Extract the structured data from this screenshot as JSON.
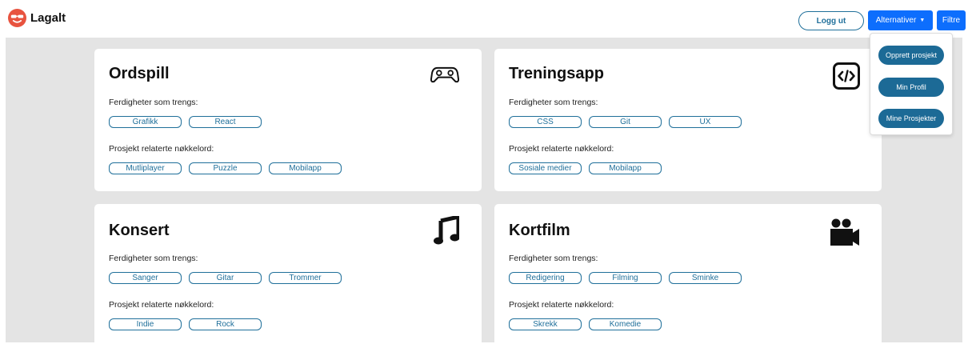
{
  "brand": {
    "name": "Lagalt"
  },
  "nav": {
    "logout": "Logg ut",
    "alternatives": "Alternativer",
    "filter": "Filtre"
  },
  "dropdown": {
    "items": [
      "Opprett prosjekt",
      "Min Profil",
      "Mine Prosjekter"
    ]
  },
  "projects": [
    {
      "title": "Ordspill",
      "icon": "gamepad-icon",
      "skills_label": "Ferdigheter som trengs:",
      "skills": [
        "Grafikk",
        "React"
      ],
      "keywords_label": "Prosjekt relaterte nøkkelord:",
      "keywords": [
        "Mutliplayer",
        "Puzzle",
        "Mobilapp"
      ]
    },
    {
      "title": "Treningsapp",
      "icon": "code-icon",
      "skills_label": "Ferdigheter som trengs:",
      "skills": [
        "CSS",
        "Git",
        "UX"
      ],
      "keywords_label": "Prosjekt relaterte nøkkelord:",
      "keywords": [
        "Sosiale medier",
        "Mobilapp"
      ]
    },
    {
      "title": "Konsert",
      "icon": "music-note-icon",
      "skills_label": "Ferdigheter som trengs:",
      "skills": [
        "Sanger",
        "Gitar",
        "Trommer"
      ],
      "keywords_label": "Prosjekt relaterte nøkkelord:",
      "keywords": [
        "Indie",
        "Rock"
      ]
    },
    {
      "title": "Kortfilm",
      "icon": "video-camera-icon",
      "skills_label": "Ferdigheter som trengs:",
      "skills": [
        "Redigering",
        "Filming",
        "Sminke"
      ],
      "keywords_label": "Prosjekt relaterte nøkkelord:",
      "keywords": [
        "Skrekk",
        "Komedie"
      ]
    }
  ],
  "colors": {
    "primary": "#0d6efd",
    "tag": "#1f6f9a",
    "dropdown_button": "#1c6a96",
    "logo": "#e8533f",
    "background": "#e4e4e4"
  }
}
